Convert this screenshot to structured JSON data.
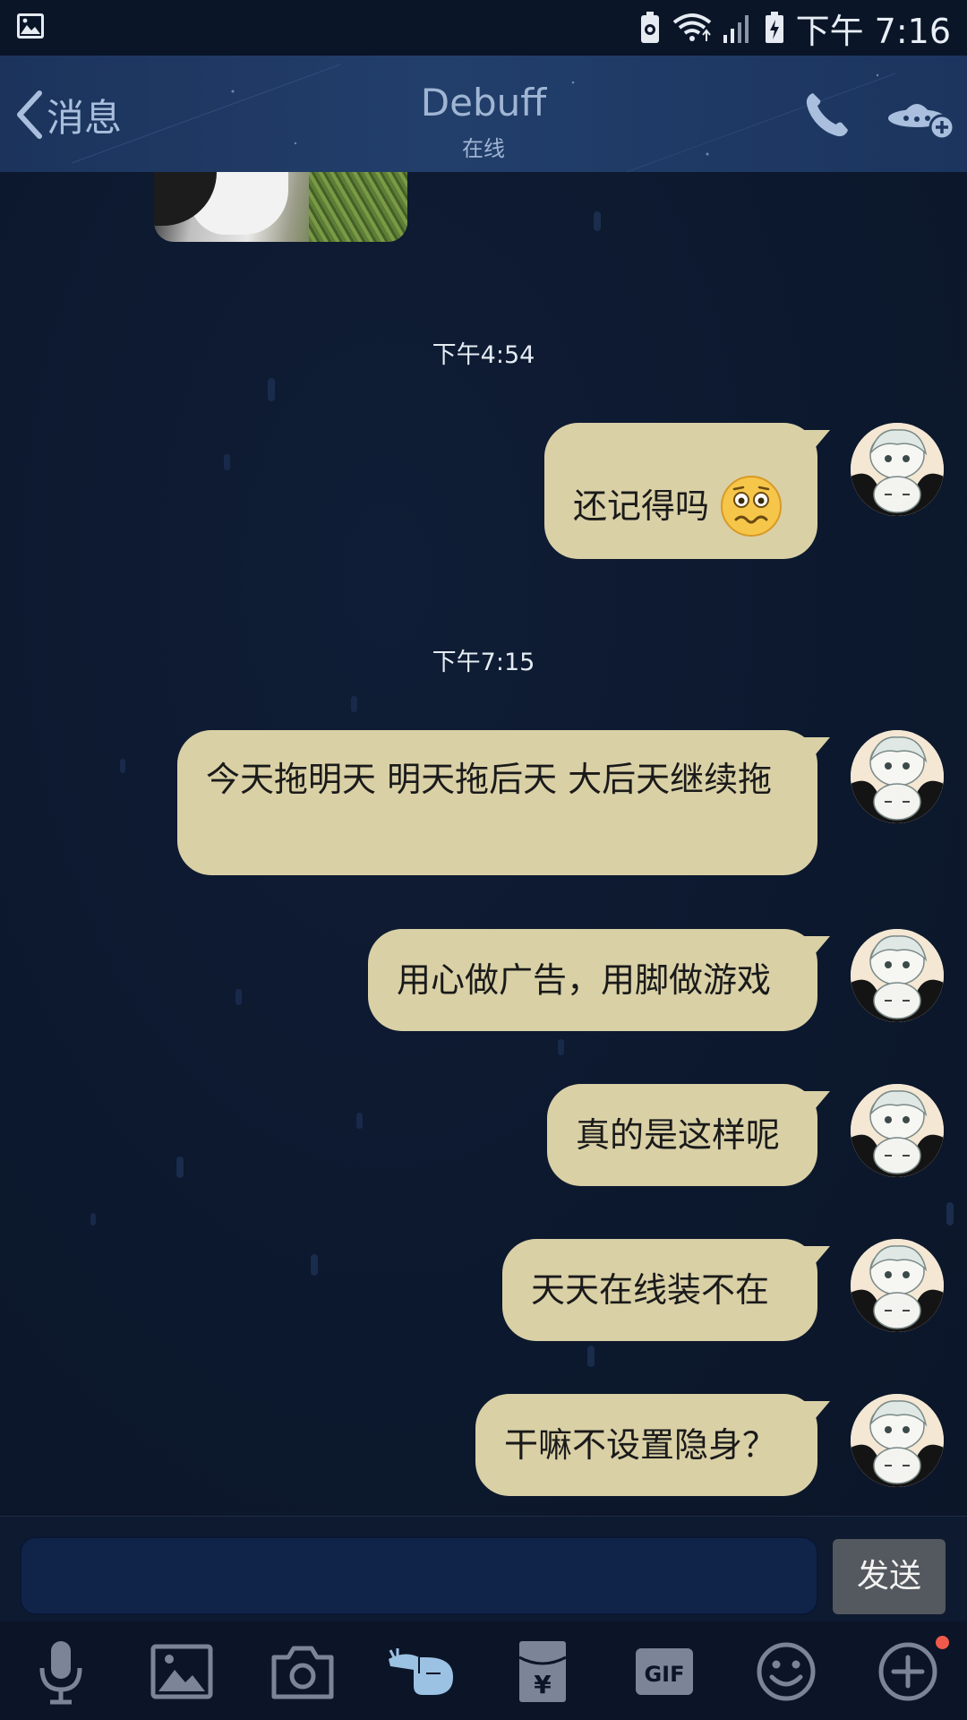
{
  "status_bar": {
    "time": "下午 7:16",
    "icons": [
      "image-icon",
      "battery-saver-icon",
      "wifi-icon",
      "signal-icon",
      "battery-charging-icon"
    ]
  },
  "header": {
    "back_label": "消息",
    "title": "Debuff",
    "subtitle": "在线",
    "icons": [
      "back-chevron-icon",
      "phone-icon",
      "ufo-add-icon"
    ],
    "accent_color": "#a9bfdd"
  },
  "chat": {
    "timestamps": [
      "下午4:54",
      "下午7:15"
    ],
    "messages": [
      {
        "text": "还记得吗",
        "has_emoji": true,
        "emoji": "worried-face-emoji"
      },
      {
        "text": "今天拖明天 明天拖后天 大后天继续拖"
      },
      {
        "text": "用心做广告，用脚做游戏"
      },
      {
        "text": "真的是这样呢"
      },
      {
        "text": "天天在线装不在"
      },
      {
        "text": "干嘛不设置隐身？"
      }
    ],
    "bubble_color": "#d9d0a6"
  },
  "input_bar": {
    "placeholder": "",
    "send_label": "发送"
  },
  "toolbar": {
    "icons": [
      "microphone-icon",
      "image-icon",
      "camera-icon",
      "poke-hand-icon",
      "red-envelope-icon",
      "gif-icon",
      "emoji-icon",
      "plus-icon"
    ],
    "gif_label": "GIF",
    "notification_dot_color": "#f05a4a"
  }
}
